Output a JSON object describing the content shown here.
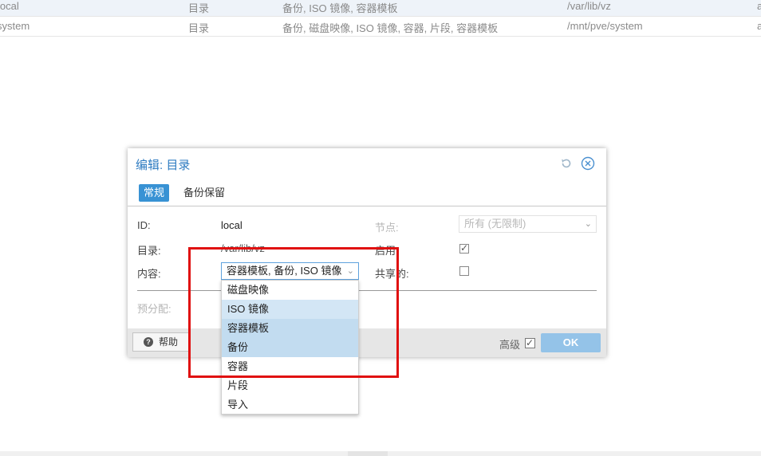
{
  "storage_rows": [
    {
      "id": "local",
      "type": "目录",
      "content": "备份, ISO 镜像, 容器模板",
      "path": "/var/lib/vz",
      "extra": "a"
    },
    {
      "id": "system",
      "type": "目录",
      "content": "备份, 磁盘映像, ISO 镜像, 容器, 片段, 容器模板",
      "path": "/mnt/pve/system",
      "extra": "a"
    }
  ],
  "dialog": {
    "title": "编辑: 目录",
    "tabs": [
      "常规",
      "备份保留"
    ],
    "id_label": "ID:",
    "id_value": "local",
    "dir_label": "目录:",
    "dir_value": "/var/lib/vz",
    "content_label": "内容:",
    "content_value": "容器模板, 备份, ISO 镜像",
    "node_label": "节点:",
    "node_value": "所有 (无限制)",
    "enable_label": "启用:",
    "shared_label": "共享的:",
    "prealloc_label": "预分配:",
    "help_label": "帮助",
    "advanced_label": "高级",
    "ok_label": "OK"
  },
  "content_options": [
    {
      "label": "磁盘映像",
      "state": "none"
    },
    {
      "label": "ISO 镜像",
      "state": "hover"
    },
    {
      "label": "容器模板",
      "state": "selected"
    },
    {
      "label": "备份",
      "state": "selected"
    },
    {
      "label": "容器",
      "state": "none"
    },
    {
      "label": "片段",
      "state": "none"
    },
    {
      "label": "导入",
      "state": "none"
    }
  ],
  "colors": {
    "accent": "#3892d4",
    "title": "#2e7bc1",
    "ok_button": "#94c3e8",
    "highlight_box": "#e01010"
  }
}
